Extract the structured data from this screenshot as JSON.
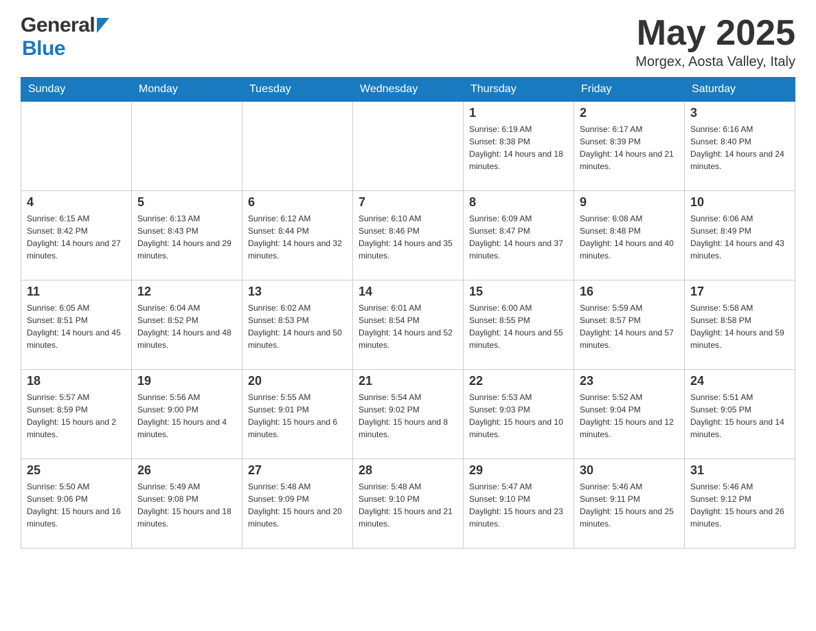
{
  "header": {
    "month_year": "May 2025",
    "location": "Morgex, Aosta Valley, Italy",
    "logo_general": "General",
    "logo_blue": "Blue"
  },
  "days_of_week": [
    "Sunday",
    "Monday",
    "Tuesday",
    "Wednesday",
    "Thursday",
    "Friday",
    "Saturday"
  ],
  "weeks": [
    [
      {
        "day": "",
        "sunrise": "",
        "sunset": "",
        "daylight": ""
      },
      {
        "day": "",
        "sunrise": "",
        "sunset": "",
        "daylight": ""
      },
      {
        "day": "",
        "sunrise": "",
        "sunset": "",
        "daylight": ""
      },
      {
        "day": "",
        "sunrise": "",
        "sunset": "",
        "daylight": ""
      },
      {
        "day": "1",
        "sunrise": "Sunrise: 6:19 AM",
        "sunset": "Sunset: 8:38 PM",
        "daylight": "Daylight: 14 hours and 18 minutes."
      },
      {
        "day": "2",
        "sunrise": "Sunrise: 6:17 AM",
        "sunset": "Sunset: 8:39 PM",
        "daylight": "Daylight: 14 hours and 21 minutes."
      },
      {
        "day": "3",
        "sunrise": "Sunrise: 6:16 AM",
        "sunset": "Sunset: 8:40 PM",
        "daylight": "Daylight: 14 hours and 24 minutes."
      }
    ],
    [
      {
        "day": "4",
        "sunrise": "Sunrise: 6:15 AM",
        "sunset": "Sunset: 8:42 PM",
        "daylight": "Daylight: 14 hours and 27 minutes."
      },
      {
        "day": "5",
        "sunrise": "Sunrise: 6:13 AM",
        "sunset": "Sunset: 8:43 PM",
        "daylight": "Daylight: 14 hours and 29 minutes."
      },
      {
        "day": "6",
        "sunrise": "Sunrise: 6:12 AM",
        "sunset": "Sunset: 8:44 PM",
        "daylight": "Daylight: 14 hours and 32 minutes."
      },
      {
        "day": "7",
        "sunrise": "Sunrise: 6:10 AM",
        "sunset": "Sunset: 8:46 PM",
        "daylight": "Daylight: 14 hours and 35 minutes."
      },
      {
        "day": "8",
        "sunrise": "Sunrise: 6:09 AM",
        "sunset": "Sunset: 8:47 PM",
        "daylight": "Daylight: 14 hours and 37 minutes."
      },
      {
        "day": "9",
        "sunrise": "Sunrise: 6:08 AM",
        "sunset": "Sunset: 8:48 PM",
        "daylight": "Daylight: 14 hours and 40 minutes."
      },
      {
        "day": "10",
        "sunrise": "Sunrise: 6:06 AM",
        "sunset": "Sunset: 8:49 PM",
        "daylight": "Daylight: 14 hours and 43 minutes."
      }
    ],
    [
      {
        "day": "11",
        "sunrise": "Sunrise: 6:05 AM",
        "sunset": "Sunset: 8:51 PM",
        "daylight": "Daylight: 14 hours and 45 minutes."
      },
      {
        "day": "12",
        "sunrise": "Sunrise: 6:04 AM",
        "sunset": "Sunset: 8:52 PM",
        "daylight": "Daylight: 14 hours and 48 minutes."
      },
      {
        "day": "13",
        "sunrise": "Sunrise: 6:02 AM",
        "sunset": "Sunset: 8:53 PM",
        "daylight": "Daylight: 14 hours and 50 minutes."
      },
      {
        "day": "14",
        "sunrise": "Sunrise: 6:01 AM",
        "sunset": "Sunset: 8:54 PM",
        "daylight": "Daylight: 14 hours and 52 minutes."
      },
      {
        "day": "15",
        "sunrise": "Sunrise: 6:00 AM",
        "sunset": "Sunset: 8:55 PM",
        "daylight": "Daylight: 14 hours and 55 minutes."
      },
      {
        "day": "16",
        "sunrise": "Sunrise: 5:59 AM",
        "sunset": "Sunset: 8:57 PM",
        "daylight": "Daylight: 14 hours and 57 minutes."
      },
      {
        "day": "17",
        "sunrise": "Sunrise: 5:58 AM",
        "sunset": "Sunset: 8:58 PM",
        "daylight": "Daylight: 14 hours and 59 minutes."
      }
    ],
    [
      {
        "day": "18",
        "sunrise": "Sunrise: 5:57 AM",
        "sunset": "Sunset: 8:59 PM",
        "daylight": "Daylight: 15 hours and 2 minutes."
      },
      {
        "day": "19",
        "sunrise": "Sunrise: 5:56 AM",
        "sunset": "Sunset: 9:00 PM",
        "daylight": "Daylight: 15 hours and 4 minutes."
      },
      {
        "day": "20",
        "sunrise": "Sunrise: 5:55 AM",
        "sunset": "Sunset: 9:01 PM",
        "daylight": "Daylight: 15 hours and 6 minutes."
      },
      {
        "day": "21",
        "sunrise": "Sunrise: 5:54 AM",
        "sunset": "Sunset: 9:02 PM",
        "daylight": "Daylight: 15 hours and 8 minutes."
      },
      {
        "day": "22",
        "sunrise": "Sunrise: 5:53 AM",
        "sunset": "Sunset: 9:03 PM",
        "daylight": "Daylight: 15 hours and 10 minutes."
      },
      {
        "day": "23",
        "sunrise": "Sunrise: 5:52 AM",
        "sunset": "Sunset: 9:04 PM",
        "daylight": "Daylight: 15 hours and 12 minutes."
      },
      {
        "day": "24",
        "sunrise": "Sunrise: 5:51 AM",
        "sunset": "Sunset: 9:05 PM",
        "daylight": "Daylight: 15 hours and 14 minutes."
      }
    ],
    [
      {
        "day": "25",
        "sunrise": "Sunrise: 5:50 AM",
        "sunset": "Sunset: 9:06 PM",
        "daylight": "Daylight: 15 hours and 16 minutes."
      },
      {
        "day": "26",
        "sunrise": "Sunrise: 5:49 AM",
        "sunset": "Sunset: 9:08 PM",
        "daylight": "Daylight: 15 hours and 18 minutes."
      },
      {
        "day": "27",
        "sunrise": "Sunrise: 5:48 AM",
        "sunset": "Sunset: 9:09 PM",
        "daylight": "Daylight: 15 hours and 20 minutes."
      },
      {
        "day": "28",
        "sunrise": "Sunrise: 5:48 AM",
        "sunset": "Sunset: 9:10 PM",
        "daylight": "Daylight: 15 hours and 21 minutes."
      },
      {
        "day": "29",
        "sunrise": "Sunrise: 5:47 AM",
        "sunset": "Sunset: 9:10 PM",
        "daylight": "Daylight: 15 hours and 23 minutes."
      },
      {
        "day": "30",
        "sunrise": "Sunrise: 5:46 AM",
        "sunset": "Sunset: 9:11 PM",
        "daylight": "Daylight: 15 hours and 25 minutes."
      },
      {
        "day": "31",
        "sunrise": "Sunrise: 5:46 AM",
        "sunset": "Sunset: 9:12 PM",
        "daylight": "Daylight: 15 hours and 26 minutes."
      }
    ]
  ]
}
